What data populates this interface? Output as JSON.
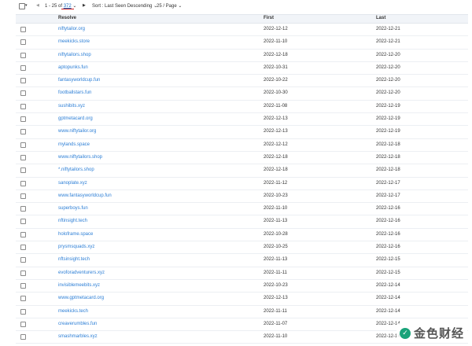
{
  "toolbar": {
    "select_caret": "▾",
    "prev_icon": "◀",
    "range_prefix": "1 - 25 of",
    "total": "372",
    "total_caret": "⌄",
    "next_icon": "▶",
    "sort_label": "Sort : Last Seen Descending",
    "sort_caret": "⌄",
    "per_page_label": "25 / Page",
    "per_page_caret": "⌄"
  },
  "columns": {
    "resolve": "Resolve",
    "first": "First",
    "last": "Last"
  },
  "rows": [
    {
      "resolve": "niftytailor.org",
      "first": "2022-12-12",
      "last": "2022-12-21"
    },
    {
      "resolve": "meekicks.store",
      "first": "2022-11-10",
      "last": "2022-12-21"
    },
    {
      "resolve": "niftytailors.shop",
      "first": "2022-12-18",
      "last": "2022-12-20"
    },
    {
      "resolve": "aptopunks.fun",
      "first": "2022-10-31",
      "last": "2022-12-20"
    },
    {
      "resolve": "fantasyworldcup.fun",
      "first": "2022-10-22",
      "last": "2022-12-20"
    },
    {
      "resolve": "footballstars.fun",
      "first": "2022-10-30",
      "last": "2022-12-20"
    },
    {
      "resolve": "sushibits.xyz",
      "first": "2022-11-08",
      "last": "2022-12-19"
    },
    {
      "resolve": "gptmetacard.org",
      "first": "2022-12-13",
      "last": "2022-12-19"
    },
    {
      "resolve": "www.niftytailor.org",
      "first": "2022-12-13",
      "last": "2022-12-19"
    },
    {
      "resolve": "mylands.space",
      "first": "2022-12-12",
      "last": "2022-12-18"
    },
    {
      "resolve": "www.niftytailors.shop",
      "first": "2022-12-18",
      "last": "2022-12-18"
    },
    {
      "resolve": "*.niftytailors.shop",
      "first": "2022-12-18",
      "last": "2022-12-18"
    },
    {
      "resolve": "sanoplate.xyz",
      "first": "2022-11-12",
      "last": "2022-12-17"
    },
    {
      "resolve": "www.fantasyworldcup.fun",
      "first": "2022-10-23",
      "last": "2022-12-17"
    },
    {
      "resolve": "superboys.fun",
      "first": "2022-11-10",
      "last": "2022-12-16"
    },
    {
      "resolve": "nftinsight.tech",
      "first": "2022-11-13",
      "last": "2022-12-16"
    },
    {
      "resolve": "holoframe.space",
      "first": "2022-10-28",
      "last": "2022-12-16"
    },
    {
      "resolve": "prysmsquads.xyz",
      "first": "2022-10-25",
      "last": "2022-12-16"
    },
    {
      "resolve": "nftsinsight.tech",
      "first": "2022-11-13",
      "last": "2022-12-15"
    },
    {
      "resolve": "evoforadventurers.xyz",
      "first": "2022-11-11",
      "last": "2022-12-15"
    },
    {
      "resolve": "invisiblemeebits.xyz",
      "first": "2022-10-23",
      "last": "2022-12-14"
    },
    {
      "resolve": "www.gptmetacard.org",
      "first": "2022-12-13",
      "last": "2022-12-14"
    },
    {
      "resolve": "meekicks.tech",
      "first": "2022-11-11",
      "last": "2022-12-14"
    },
    {
      "resolve": "creaverumbles.fun",
      "first": "2022-11-07",
      "last": "2022-12-14"
    },
    {
      "resolve": "smashmarbles.xyz",
      "first": "2022-11-10",
      "last": "2022-12-14"
    }
  ],
  "watermark": {
    "logo_glyph": "✓",
    "text": "金色财经"
  }
}
